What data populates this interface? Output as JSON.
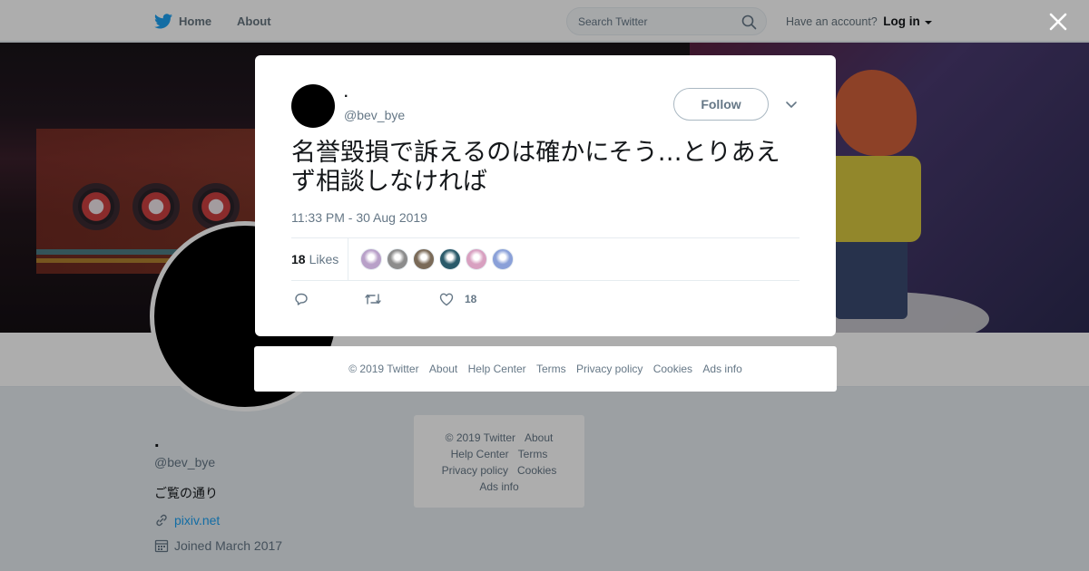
{
  "topbar": {
    "home_label": "Home",
    "about_label": "About",
    "search_placeholder": "Search Twitter",
    "account_prompt": "Have an account?",
    "login_label": "Log in"
  },
  "profile": {
    "name": ".",
    "handle": "@bev_bye",
    "bio": "ご覧の通り",
    "link": "pixiv.net",
    "joined": "Joined March 2017"
  },
  "side_footer": {
    "links": [
      "© 2019 Twitter",
      "About",
      "Help Center",
      "Terms",
      "Privacy policy",
      "Cookies",
      "Ads info"
    ]
  },
  "tweet": {
    "author_name": ".",
    "author_handle": "@bev_bye",
    "follow_label": "Follow",
    "text": "名誉毀損で訴えるのは確かにそう…とりあえず相談しなければ",
    "timestamp": "11:33 PM - 30 Aug 2019",
    "likes_number": "18",
    "likes_label": "Likes",
    "like_action_count": "18"
  },
  "likers": [
    {
      "color": "#b8a0c8"
    },
    {
      "color": "#8c8c8c"
    },
    {
      "color": "#7a6a58"
    },
    {
      "color": "#2a5a6a"
    },
    {
      "color": "#d8a0c0"
    },
    {
      "color": "#8aa0d8"
    }
  ],
  "modal_footer": {
    "links": [
      "© 2019 Twitter",
      "About",
      "Help Center",
      "Terms",
      "Privacy policy",
      "Cookies",
      "Ads info"
    ]
  },
  "colors": {
    "accent": "#1da1f2",
    "text_secondary": "#657786"
  },
  "icons": {
    "brand": "twitter-bird-icon",
    "search": "search-icon",
    "close": "close-icon",
    "reply": "reply-icon",
    "retweet": "retweet-icon",
    "like": "heart-icon",
    "link": "link-icon",
    "calendar": "calendar-icon",
    "more": "chevron-down-icon"
  }
}
